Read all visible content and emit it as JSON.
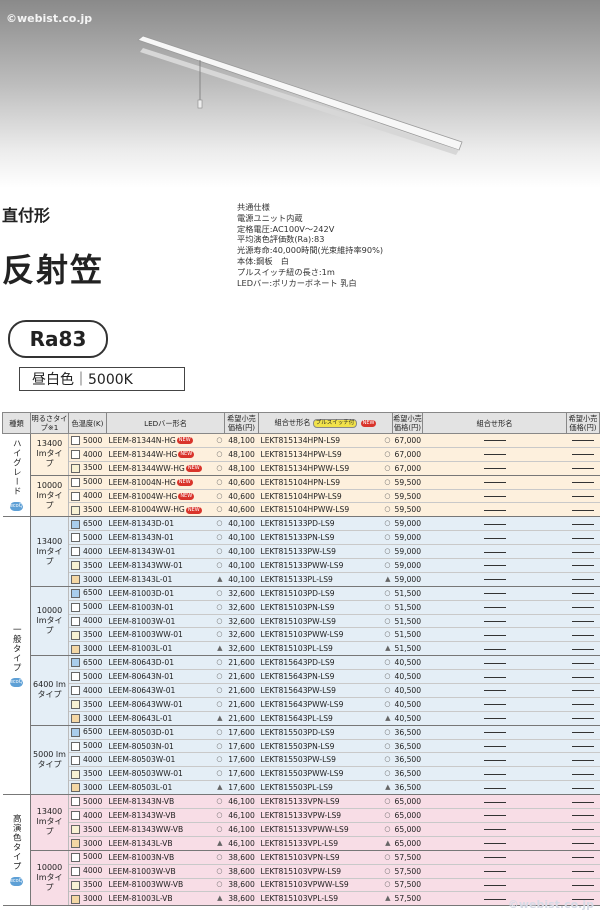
{
  "watermark": "©webist.co.jp",
  "heading": {
    "mount_type": "直付形",
    "product_type": "反射笠"
  },
  "specs": [
    "共通仕様",
    "電源ユニット内蔵",
    "定格電圧:AC100V〜242V",
    "平均演色評価数(Ra):83",
    "光源寿命:40,000時間(光束維持率90%)",
    "本体:鋼板　白",
    "プルスイッチ紐の長さ:1m",
    "LEDバー:ポリカーボネート 乳白"
  ],
  "ra_badge": "Ra83",
  "color_temp_label": "昼白色｜5000K",
  "table": {
    "headers": [
      "種類",
      "明るさタイプ※1",
      "色温度(K)",
      "LEDバー形名",
      "希望小売価格(円)",
      "組合せ形名",
      "希望小売価格(円)",
      "組合せ形名",
      "希望小売価格(円)"
    ],
    "switch_badge": "プルスイッチ付",
    "new_badge": "NEW",
    "group_icon": "ecoQ",
    "groups": [
      {
        "type": "ハイグレード",
        "bg": "o",
        "subgroups": [
          {
            "lumen": "13400 lmタイプ",
            "rows": [
              {
                "k": "5000",
                "bar": "LEEM-81344N-HG",
                "nw": true,
                "mk": "○",
                "p1": "48,100",
                "combo": "LEKT815134HPN-LS9",
                "ck": "○",
                "p2": "67,000"
              },
              {
                "k": "4000",
                "bar": "LEEM-81344W-HG",
                "nw": true,
                "mk": "○",
                "p1": "48,100",
                "combo": "LEKT815134HPW-LS9",
                "ck": "○",
                "p2": "67,000"
              },
              {
                "k": "3500",
                "bar": "LEEM-81344WW-HG",
                "nw": true,
                "mk": "○",
                "p1": "48,100",
                "combo": "LEKT815134HPWW-LS9",
                "ck": "○",
                "p2": "67,000"
              }
            ]
          },
          {
            "lumen": "10000 lmタイプ",
            "rows": [
              {
                "k": "5000",
                "bar": "LEEM-81004N-HG",
                "nw": true,
                "mk": "○",
                "p1": "40,600",
                "combo": "LEKT815104HPN-LS9",
                "ck": "○",
                "p2": "59,500"
              },
              {
                "k": "4000",
                "bar": "LEEM-81004W-HG",
                "nw": true,
                "mk": "○",
                "p1": "40,600",
                "combo": "LEKT815104HPW-LS9",
                "ck": "○",
                "p2": "59,500"
              },
              {
                "k": "3500",
                "bar": "LEEM-81004WW-HG",
                "nw": true,
                "mk": "○",
                "p1": "40,600",
                "combo": "LEKT815104HPWW-LS9",
                "ck": "○",
                "p2": "59,500"
              }
            ]
          }
        ]
      },
      {
        "type": "一般タイプ",
        "bg": "b",
        "subgroups": [
          {
            "lumen": "13400 lmタイプ",
            "rows": [
              {
                "k": "6500",
                "bar": "LEEM-81343D-01",
                "mk": "○",
                "p1": "40,100",
                "combo": "LEKT815133PD-LS9",
                "ck": "○",
                "p2": "59,000"
              },
              {
                "k": "5000",
                "bar": "LEEM-81343N-01",
                "mk": "○",
                "p1": "40,100",
                "combo": "LEKT815133PN-LS9",
                "ck": "○",
                "p2": "59,000"
              },
              {
                "k": "4000",
                "bar": "LEEM-81343W-01",
                "mk": "○",
                "p1": "40,100",
                "combo": "LEKT815133PW-LS9",
                "ck": "○",
                "p2": "59,000"
              },
              {
                "k": "3500",
                "bar": "LEEM-81343WW-01",
                "mk": "○",
                "p1": "40,100",
                "combo": "LEKT815133PWW-LS9",
                "ck": "○",
                "p2": "59,000"
              },
              {
                "k": "3000",
                "bar": "LEEM-81343L-01",
                "mk": "▲",
                "p1": "40,100",
                "combo": "LEKT815133PL-LS9",
                "ck": "▲",
                "p2": "59,000"
              }
            ]
          },
          {
            "lumen": "10000 lmタイプ",
            "rows": [
              {
                "k": "6500",
                "bar": "LEEM-81003D-01",
                "mk": "○",
                "p1": "32,600",
                "combo": "LEKT815103PD-LS9",
                "ck": "○",
                "p2": "51,500"
              },
              {
                "k": "5000",
                "bar": "LEEM-81003N-01",
                "mk": "○",
                "p1": "32,600",
                "combo": "LEKT815103PN-LS9",
                "ck": "○",
                "p2": "51,500"
              },
              {
                "k": "4000",
                "bar": "LEEM-81003W-01",
                "mk": "○",
                "p1": "32,600",
                "combo": "LEKT815103PW-LS9",
                "ck": "○",
                "p2": "51,500"
              },
              {
                "k": "3500",
                "bar": "LEEM-81003WW-01",
                "mk": "○",
                "p1": "32,600",
                "combo": "LEKT815103PWW-LS9",
                "ck": "○",
                "p2": "51,500"
              },
              {
                "k": "3000",
                "bar": "LEEM-81003L-01",
                "mk": "▲",
                "p1": "32,600",
                "combo": "LEKT815103PL-LS9",
                "ck": "▲",
                "p2": "51,500"
              }
            ]
          },
          {
            "lumen": "6400 lmタイプ",
            "rows": [
              {
                "k": "6500",
                "bar": "LEEM-80643D-01",
                "mk": "○",
                "p1": "21,600",
                "combo": "LEKT815643PD-LS9",
                "ck": "○",
                "p2": "40,500"
              },
              {
                "k": "5000",
                "bar": "LEEM-80643N-01",
                "mk": "○",
                "p1": "21,600",
                "combo": "LEKT815643PN-LS9",
                "ck": "○",
                "p2": "40,500"
              },
              {
                "k": "4000",
                "bar": "LEEM-80643W-01",
                "mk": "○",
                "p1": "21,600",
                "combo": "LEKT815643PW-LS9",
                "ck": "○",
                "p2": "40,500"
              },
              {
                "k": "3500",
                "bar": "LEEM-80643WW-01",
                "mk": "○",
                "p1": "21,600",
                "combo": "LEKT815643PWW-LS9",
                "ck": "○",
                "p2": "40,500"
              },
              {
                "k": "3000",
                "bar": "LEEM-80643L-01",
                "mk": "▲",
                "p1": "21,600",
                "combo": "LEKT815643PL-LS9",
                "ck": "▲",
                "p2": "40,500"
              }
            ]
          },
          {
            "lumen": "5000 lmタイプ",
            "rows": [
              {
                "k": "6500",
                "bar": "LEEM-80503D-01",
                "mk": "○",
                "p1": "17,600",
                "combo": "LEKT815503PD-LS9",
                "ck": "○",
                "p2": "36,500"
              },
              {
                "k": "5000",
                "bar": "LEEM-80503N-01",
                "mk": "○",
                "p1": "17,600",
                "combo": "LEKT815503PN-LS9",
                "ck": "○",
                "p2": "36,500"
              },
              {
                "k": "4000",
                "bar": "LEEM-80503W-01",
                "mk": "○",
                "p1": "17,600",
                "combo": "LEKT815503PW-LS9",
                "ck": "○",
                "p2": "36,500"
              },
              {
                "k": "3500",
                "bar": "LEEM-80503WW-01",
                "mk": "○",
                "p1": "17,600",
                "combo": "LEKT815503PWW-LS9",
                "ck": "○",
                "p2": "36,500"
              },
              {
                "k": "3000",
                "bar": "LEEM-80503L-01",
                "mk": "▲",
                "p1": "17,600",
                "combo": "LEKT815503PL-LS9",
                "ck": "▲",
                "p2": "36,500"
              }
            ]
          }
        ]
      },
      {
        "type": "高演色タイプ",
        "bg": "p",
        "subgroups": [
          {
            "lumen": "13400 lmタイプ",
            "rows": [
              {
                "k": "5000",
                "bar": "LEEM-81343N-VB",
                "mk": "○",
                "p1": "46,100",
                "combo": "LEKT815133VPN-LS9",
                "ck": "○",
                "p2": "65,000"
              },
              {
                "k": "4000",
                "bar": "LEEM-81343W-VB",
                "mk": "○",
                "p1": "46,100",
                "combo": "LEKT815133VPW-LS9",
                "ck": "○",
                "p2": "65,000"
              },
              {
                "k": "3500",
                "bar": "LEEM-81343WW-VB",
                "mk": "○",
                "p1": "46,100",
                "combo": "LEKT815133VPWW-LS9",
                "ck": "○",
                "p2": "65,000"
              },
              {
                "k": "3000",
                "bar": "LEEM-81343L-VB",
                "mk": "▲",
                "p1": "46,100",
                "combo": "LEKT815133VPL-LS9",
                "ck": "▲",
                "p2": "65,000"
              }
            ]
          },
          {
            "lumen": "10000 lmタイプ",
            "rows": [
              {
                "k": "5000",
                "bar": "LEEM-81003N-VB",
                "mk": "○",
                "p1": "38,600",
                "combo": "LEKT815103VPN-LS9",
                "ck": "○",
                "p2": "57,500"
              },
              {
                "k": "4000",
                "bar": "LEEM-81003W-VB",
                "mk": "○",
                "p1": "38,600",
                "combo": "LEKT815103VPW-LS9",
                "ck": "○",
                "p2": "57,500"
              },
              {
                "k": "3500",
                "bar": "LEEM-81003WW-VB",
                "mk": "○",
                "p1": "38,600",
                "combo": "LEKT815103VPWW-LS9",
                "ck": "○",
                "p2": "57,500"
              },
              {
                "k": "3000",
                "bar": "LEEM-81003L-VB",
                "mk": "▲",
                "p1": "38,600",
                "combo": "LEKT815103VPL-LS9",
                "ck": "▲",
                "p2": "57,500"
              }
            ]
          }
        ]
      }
    ]
  },
  "colors": {
    "header_bg": "#e3e3e3",
    "row_orange": "#fdf0dd",
    "row_blue": "#e4eef6",
    "row_pink": "#f8dde6",
    "new_red": "#d9342b",
    "switch_yellow": "#f1e24a"
  },
  "swatch_colors": {
    "6500": "#a9cdec",
    "5000": "#ffffff",
    "4000": "#ffffff",
    "3500": "#f7f1d4",
    "3000": "#f4d7a4"
  }
}
